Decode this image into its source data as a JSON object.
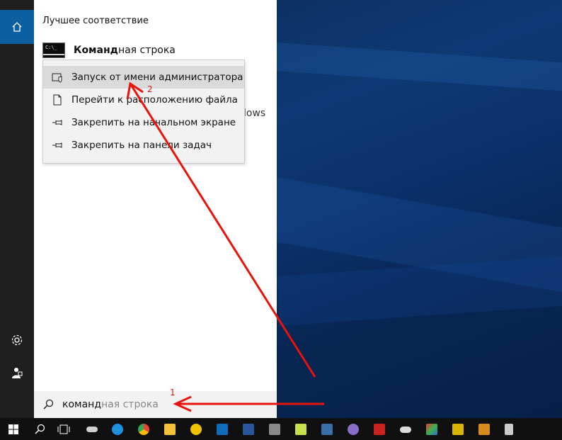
{
  "start_menu": {
    "best_match_title": "Лучшее соответствие",
    "best_match": {
      "typed": "Команд",
      "rest": "ная строка",
      "icon_text": "C:\\_"
    },
    "obscured_text": "lows",
    "context_menu": [
      {
        "label": "Запуск от имени администратора",
        "icon": "shield-window-icon",
        "highlighted": true
      },
      {
        "label": "Перейти к расположению файла",
        "icon": "file-location-icon",
        "highlighted": false
      },
      {
        "label": "Закрепить на начальном экране",
        "icon": "pin-icon",
        "highlighted": false
      },
      {
        "label": "Закрепить на панели задач",
        "icon": "pin-icon",
        "highlighted": false
      }
    ]
  },
  "search": {
    "typed": "команд",
    "suggestion": "ная строка"
  },
  "annotations": {
    "step1": "1",
    "step2": "2",
    "color": "#e8140c"
  },
  "taskbar": {
    "icons": [
      {
        "name": "start-icon",
        "color": "#ffffff"
      },
      {
        "name": "search-icon",
        "color": "#ffffff"
      },
      {
        "name": "task-view-icon",
        "color": "#ffffff"
      },
      {
        "name": "cloud-icon",
        "color": "#cfcfcf"
      },
      {
        "name": "edge-icon",
        "color": "#1e90e0"
      },
      {
        "name": "chrome-icon",
        "color": "#e94335"
      },
      {
        "name": "file-explorer-icon",
        "color": "#f3c13a"
      },
      {
        "name": "triangle-app-icon",
        "color": "#f2c200"
      },
      {
        "name": "outlook-icon",
        "color": "#0f6cbd"
      },
      {
        "name": "word-icon",
        "color": "#2b579a"
      },
      {
        "name": "png-icon",
        "color": "#8a8a8a"
      },
      {
        "name": "notepad-icon",
        "color": "#c4e04a"
      },
      {
        "name": "editor-icon",
        "color": "#3a6ea8"
      },
      {
        "name": "media-icon",
        "color": "#8a6cc9"
      },
      {
        "name": "filezilla-icon",
        "color": "#c8231f"
      },
      {
        "name": "eye-icon",
        "color": "#dddddd"
      },
      {
        "name": "paint-icon",
        "color": "#3fae49"
      },
      {
        "name": "network-icon",
        "color": "#d9b400"
      },
      {
        "name": "box-icon",
        "color": "#d88a1e"
      },
      {
        "name": "calculator-icon",
        "color": "#cccccc"
      }
    ]
  }
}
